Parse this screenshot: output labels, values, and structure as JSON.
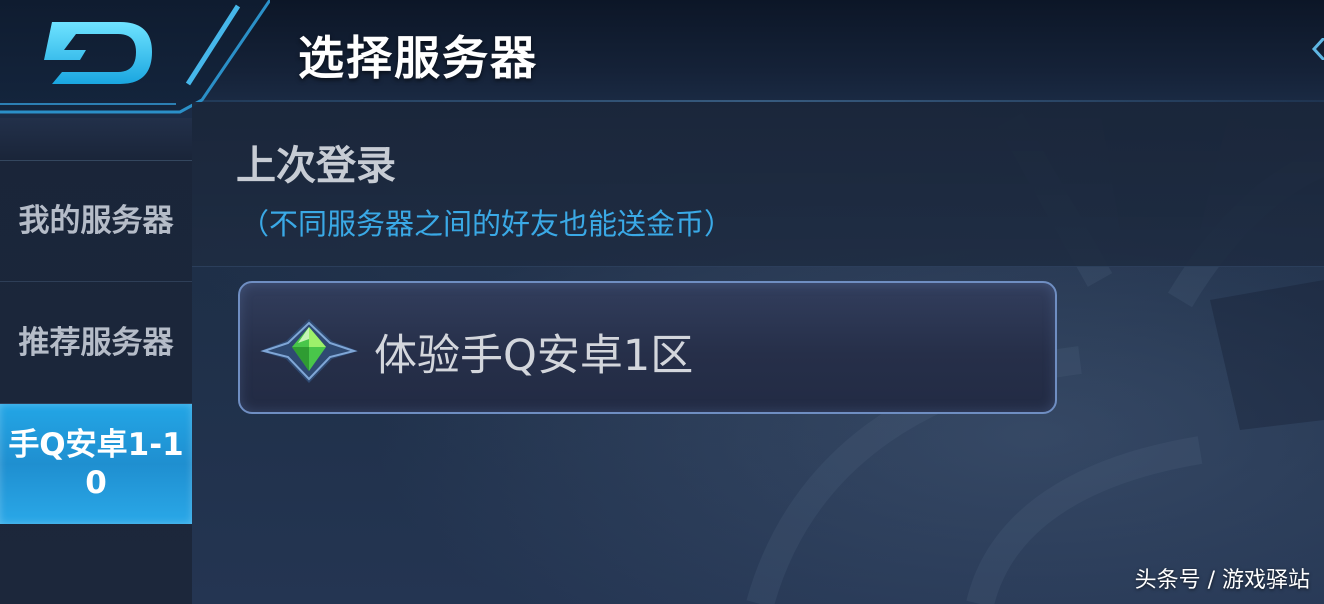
{
  "header": {
    "title": "选择服务器",
    "back_icon": "back-d-icon"
  },
  "sidebar": {
    "items": [
      {
        "label": "我的服务器",
        "active": false
      },
      {
        "label": "推荐服务器",
        "active": false
      },
      {
        "label": "手Q安卓1-10",
        "active": true
      }
    ]
  },
  "main": {
    "section_title": "上次登录",
    "section_hint": "（不同服务器之间的好友也能送金币）",
    "servers": [
      {
        "name": "体验手Q安卓1区",
        "icon": "green-gem-icon"
      }
    ]
  },
  "watermark": "头条号 / 游戏驿站",
  "colors": {
    "accent": "#23a6e6",
    "hint": "#3aa9e6",
    "card_border": "#6f8ec2"
  }
}
